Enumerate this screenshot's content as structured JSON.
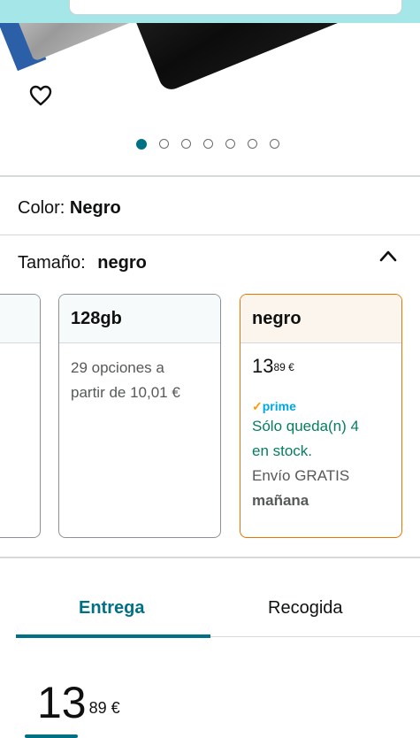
{
  "product_image": {
    "heart_icon": "heart-outline-icon",
    "carousel_dot_count": 7,
    "carousel_active_index": 0
  },
  "color_row": {
    "label": "Color:",
    "value": "Negro"
  },
  "size_row": {
    "label": "Tamaño:",
    "value": "negro",
    "chevron_icon": "chevron-up-icon"
  },
  "options": [
    {
      "name": "128gb",
      "desc_line1": "29 opciones a",
      "desc_line2": "partir de 10,01 €"
    },
    {
      "name": "negro",
      "price_whole": "13",
      "price_fraction": "89 €",
      "prime_check": "✓",
      "prime_label": "prime",
      "stock_line1": "Sólo queda(n) 4",
      "stock_line2": "en stock.",
      "shipping": "Envío GRATIS",
      "delivery": "mañana"
    }
  ],
  "tabs": {
    "delivery": "Entrega",
    "pickup": "Recogida"
  },
  "price": {
    "whole": "13",
    "fraction": "89 €"
  },
  "colors": {
    "accent": "#007185",
    "selected_border": "#e77600",
    "stock_green": "#067d62",
    "prime_blue": "#00a8e1"
  }
}
